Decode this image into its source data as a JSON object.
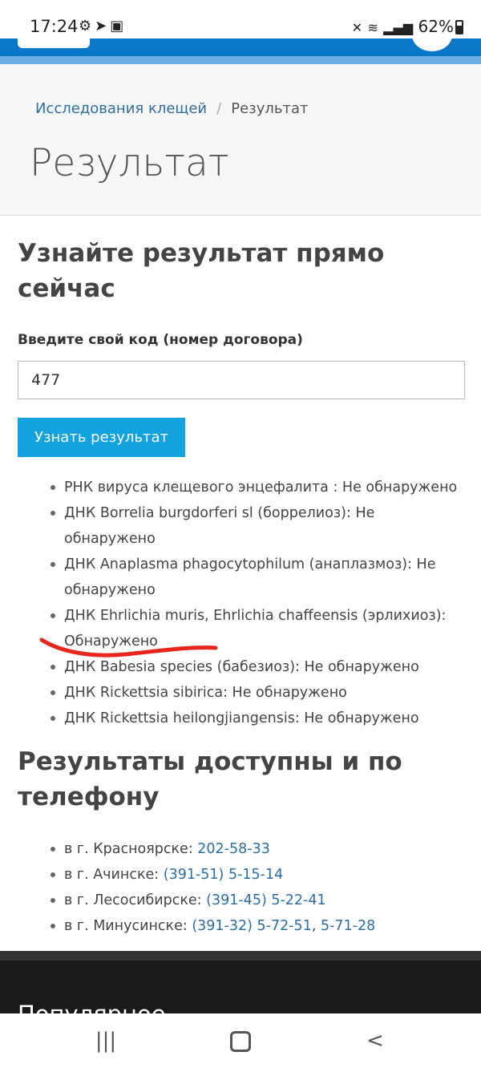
{
  "status_bar": {
    "time": "17:24",
    "left_icons": [
      "settings-gear-icon",
      "telegram-icon",
      "notification-icon"
    ],
    "battery": "62%"
  },
  "breadcrumb": {
    "link": "Исследования клещей",
    "current": "Результат"
  },
  "page_title": "Результат",
  "form": {
    "heading": "Узнайте результат прямо сейчас",
    "label": "Введите свой код (номер договора)",
    "code_value": "477",
    "submit_label": "Узнать результат"
  },
  "results": [
    "РНК вируса клещевого энцефалита : Не обнаружено",
    "ДНК Borrelia burgdorferi sl (боррелиоз): Не обнаружено",
    "ДНК Anaplasma phagocytophilum (анаплазмоз): Не обнаружено",
    "ДНК Ehrlichia muris, Ehrlichia chaffeensis (эрлихиоз): Обнаружено",
    "ДНК Babesia species (бабезиоз): Не обнаружено",
    "ДНК Rickettsia sibirica: Не обнаружено",
    "ДНК Rickettsia heilongjiangensis: Не обнаружено"
  ],
  "phones_section": {
    "heading": "Результаты доступны и по телефону",
    "items": [
      {
        "city": "в г. Красноярске: ",
        "phone": "202-58-33"
      },
      {
        "city": "в г. Ачинске: ",
        "phone": "(391-51) 5-15-14"
      },
      {
        "city": "в г. Лесосибирске: ",
        "phone": "(391-45) 5-22-41"
      },
      {
        "city": "в г. Минусинске: ",
        "phone": "(391-32) 5-72-51",
        "sep": ", ",
        "phone2": "5-71-28"
      }
    ]
  },
  "footer": {
    "heading": "Популярное"
  },
  "colors": {
    "primary": "#0a77c8",
    "button": "#12a2e0",
    "link": "#2e6e9e",
    "marker": "#e8261c"
  }
}
